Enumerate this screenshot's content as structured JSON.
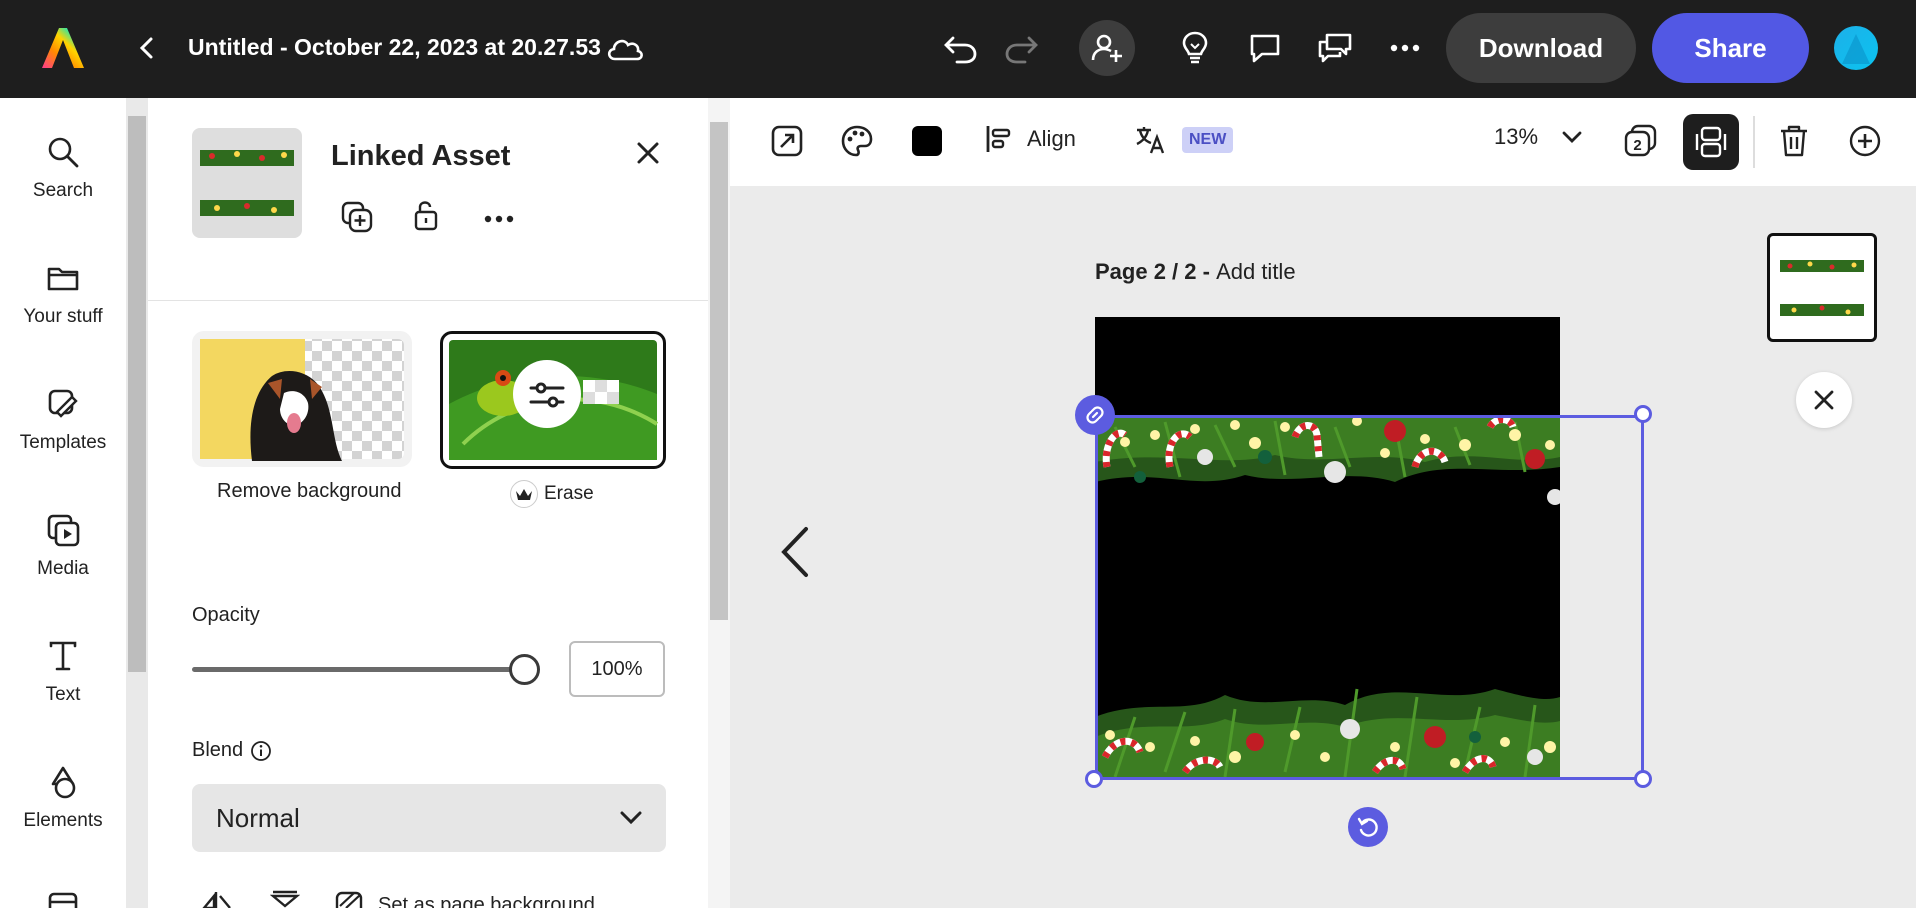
{
  "header": {
    "title": "Untitled - October 22, 2023 at 20.27.53",
    "download_label": "Download",
    "share_label": "Share",
    "icons": [
      "adobe-express-logo",
      "back-chevron",
      "cloud-icon",
      "undo-icon",
      "redo-icon",
      "invite-person-icon",
      "lightbulb-icon",
      "comment-icon",
      "chat-icon",
      "more-icon"
    ]
  },
  "sidebar": {
    "items": [
      {
        "label": "Search",
        "icon": "search-icon"
      },
      {
        "label": "Your stuff",
        "icon": "folder-icon"
      },
      {
        "label": "Templates",
        "icon": "templates-icon"
      },
      {
        "label": "Media",
        "icon": "media-icon"
      },
      {
        "label": "Text",
        "icon": "text-icon"
      },
      {
        "label": "Elements",
        "icon": "elements-icon"
      }
    ]
  },
  "panel": {
    "title": "Linked Asset",
    "quick_actions": [
      {
        "label": "Remove background"
      },
      {
        "label": "Erase"
      }
    ],
    "opacity": {
      "label": "Opacity",
      "value": "100%",
      "level": 1.0
    },
    "blend": {
      "label": "Blend",
      "value": "Normal"
    },
    "bottom_action": "Set as page background"
  },
  "canvas": {
    "toolbar": {
      "align_label": "Align",
      "new_badge": "NEW",
      "zoom": "13%"
    },
    "page": {
      "prefix": "Page 2 / 2 - ",
      "add_title": "Add title"
    }
  },
  "colors": {
    "accent": "#5c5ce0",
    "share": "#5258e4",
    "topbar": "#1e1e1e"
  }
}
